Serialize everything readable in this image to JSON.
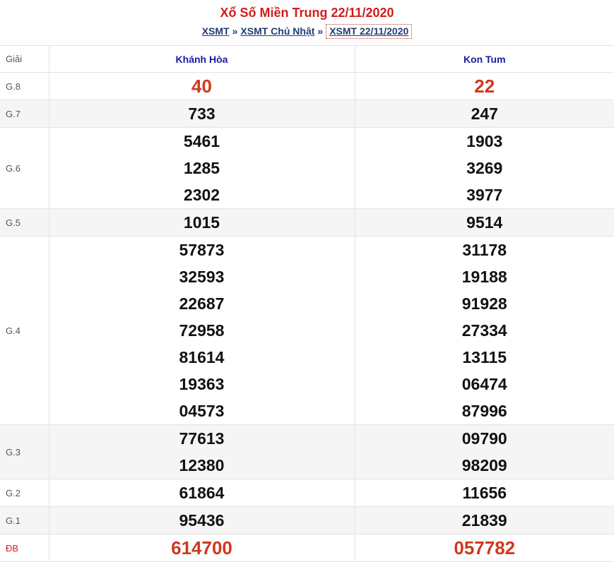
{
  "header": {
    "title": "Xổ Số Miền Trung 22/11/2020",
    "breadcrumb": [
      {
        "label": "XSMT"
      },
      {
        "label": "XSMT Chủ Nhật"
      },
      {
        "label": "XSMT 22/11/2020"
      }
    ],
    "separator": "»"
  },
  "table": {
    "prize_header": "Giải",
    "provinces": [
      "Khánh Hòa",
      "Kon Tum"
    ],
    "rows": [
      {
        "prize": "G.8",
        "values": [
          [
            "40"
          ],
          [
            "22"
          ]
        ],
        "highlight": true
      },
      {
        "prize": "G.7",
        "values": [
          [
            "733"
          ],
          [
            "247"
          ]
        ]
      },
      {
        "prize": "G.6",
        "values": [
          [
            "5461",
            "1285",
            "2302"
          ],
          [
            "1903",
            "3269",
            "3977"
          ]
        ]
      },
      {
        "prize": "G.5",
        "values": [
          [
            "1015"
          ],
          [
            "9514"
          ]
        ]
      },
      {
        "prize": "G.4",
        "values": [
          [
            "57873",
            "32593",
            "22687",
            "72958",
            "81614",
            "19363",
            "04573"
          ],
          [
            "31178",
            "19188",
            "91928",
            "27334",
            "13115",
            "06474",
            "87996"
          ]
        ]
      },
      {
        "prize": "G.3",
        "values": [
          [
            "77613",
            "12380"
          ],
          [
            "09790",
            "98209"
          ]
        ]
      },
      {
        "prize": "G.2",
        "values": [
          [
            "61864"
          ],
          [
            "11656"
          ]
        ]
      },
      {
        "prize": "G.1",
        "values": [
          [
            "95436"
          ],
          [
            "21839"
          ]
        ]
      },
      {
        "prize": "ĐB",
        "values": [
          [
            "614700"
          ],
          [
            "057782"
          ]
        ],
        "highlight": true,
        "special": true
      }
    ]
  },
  "colors": {
    "title_red": "#d21c1c",
    "number_red": "#d1381c",
    "link_blue": "#1f3d73",
    "province_blue": "#1a1a9e",
    "alt_row_bg": "#f5f5f5"
  }
}
